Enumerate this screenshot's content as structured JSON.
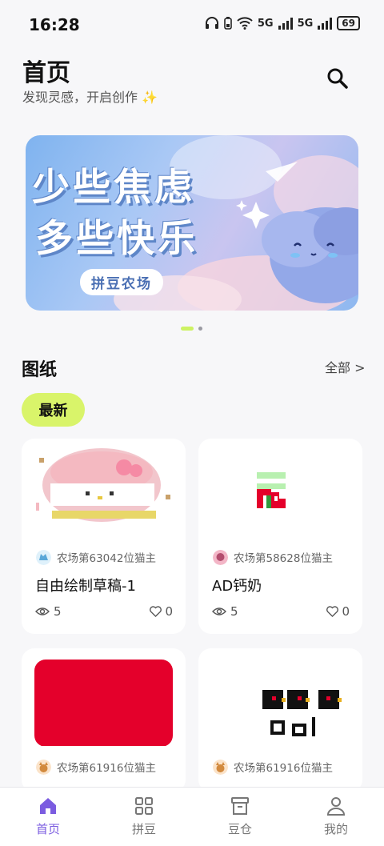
{
  "status_bar": {
    "time": "16:28",
    "net1": "5G",
    "net2": "5G",
    "battery": "69"
  },
  "header": {
    "title": "首页",
    "subtitle": "发现灵感，开启创作 ✨",
    "search_icon": "search-icon"
  },
  "banner": {
    "line1": "少些焦虑",
    "line2": "多些快乐",
    "tag": "拼豆农场"
  },
  "section": {
    "title": "图纸",
    "more": "全部 >",
    "filter_chip": "最新"
  },
  "cards": [
    {
      "author": "农场第63042位猫主",
      "name": "自由绘制草稿-1",
      "views": "5",
      "likes": "0"
    },
    {
      "author": "农场第58628位猫主",
      "name": "AD钙奶",
      "views": "5",
      "likes": "0"
    },
    {
      "author": "农场第61916位猫主",
      "name": "",
      "views": "",
      "likes": ""
    },
    {
      "author": "农场第61916位猫主",
      "name": "",
      "views": "",
      "likes": ""
    }
  ],
  "nav": [
    {
      "label": "首页",
      "icon": "home-icon",
      "active": true
    },
    {
      "label": "拼豆",
      "icon": "grid-icon",
      "active": false
    },
    {
      "label": "豆仓",
      "icon": "archive-box-icon",
      "active": false
    },
    {
      "label": "我的",
      "icon": "user-icon",
      "active": false
    }
  ],
  "colors": {
    "accent": "#7b5ce0",
    "chip": "#d9f46a",
    "dot_active": "#cdf263",
    "red_tile": "#e4002b"
  }
}
